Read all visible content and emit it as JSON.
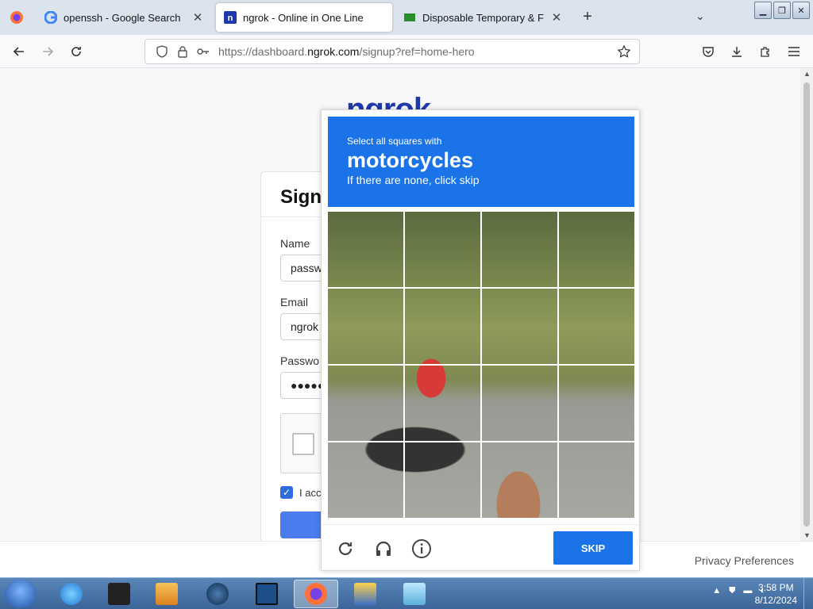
{
  "browser": {
    "tabs": [
      {
        "title": "openssh - Google Search",
        "favicon": "google-g-icon"
      },
      {
        "title": "ngrok - Online in One Line",
        "favicon": "ngrok-n-icon",
        "active": true
      },
      {
        "title": "Disposable Temporary & F",
        "favicon": "mail-icon"
      }
    ],
    "url_prefix": "https://dashboard.",
    "url_host": "ngrok.com",
    "url_path": "/signup?ref=home-hero"
  },
  "page": {
    "logo": "ngrok",
    "card_title": "Sign",
    "name_label": "Name",
    "name_value": "passw",
    "email_label": "Email",
    "email_value": "ngrok",
    "password_label": "Passwo",
    "password_value": "●●●●●",
    "terms_text": "I acc",
    "footer_link": "Privacy Preferences"
  },
  "captcha": {
    "instruction": "Select all squares with",
    "target": "motorcycles",
    "hint": "If there are none, click skip",
    "skip_label": "SKIP",
    "cells": 16
  },
  "taskbar": {
    "time": "3:58 PM",
    "date": "8/12/2024"
  },
  "colors": {
    "captcha_blue": "#1a73e8",
    "ngrok_blue": "#1f3aa8"
  }
}
